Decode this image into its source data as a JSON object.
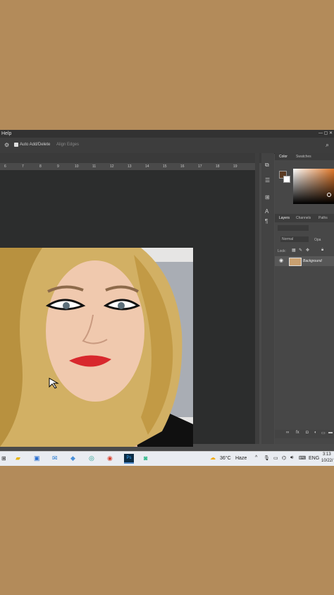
{
  "menubar": {
    "help_label": "Help",
    "window_controls": "— ▢ ✕"
  },
  "options": {
    "auto_add_delete_label": "Auto Add/Delete",
    "align_edges_label": "Align Edges",
    "search_icon": "search-icon",
    "gear_icon": "gear-icon"
  },
  "ruler": {
    "ticks": [
      "6",
      "7",
      "8",
      "9",
      "10",
      "11",
      "12",
      "13",
      "14",
      "15",
      "16",
      "17",
      "18",
      "19"
    ]
  },
  "color_panel": {
    "tabs": [
      "Color",
      "Swatches"
    ],
    "foreground_color": "#5a3a22",
    "background_color": "#ffffff",
    "picker_hue": "#e0782a"
  },
  "layers_panel": {
    "tabs": [
      "Layers",
      "Channels",
      "Paths"
    ],
    "kind_label": "Normal",
    "opacity_label": "Opa",
    "lock_label": "Lock:",
    "layers": [
      {
        "name": "Background"
      }
    ]
  },
  "taskbar": {
    "weather_temp": "36°C",
    "weather_desc": "Haze",
    "language": "ENG",
    "time": "3:13",
    "date": "10/22/"
  },
  "colors": {
    "outer_background": "#b38b5a",
    "workspace": "#2c2d2d",
    "panel": "#474747"
  }
}
